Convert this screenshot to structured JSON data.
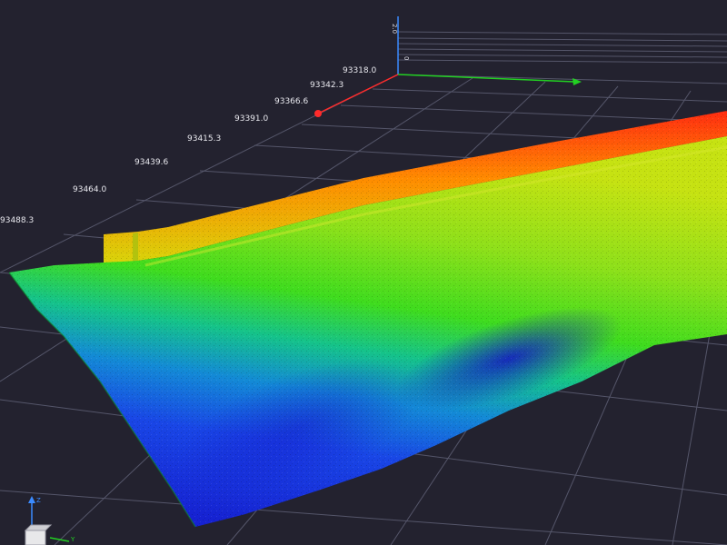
{
  "viewer": {
    "background": "#23222f",
    "grid_color": "#55566a",
    "axis_colors": {
      "x": "#ff2b2b",
      "y": "#22d022",
      "z": "#3b8bff"
    }
  },
  "axis_ticks": {
    "values": [
      "93318.0",
      "93342.3",
      "93366.6",
      "93391.0",
      "93415.3",
      "93439.6",
      "93464.0",
      "93488.3"
    ]
  },
  "z_axis_ticks": {
    "values": [
      "2.0",
      "0"
    ]
  },
  "orientation_widget": {
    "z_label": "Z",
    "y_label": "Y"
  },
  "surface": {
    "color_scale": [
      "#1a23d6",
      "#0a7ae8",
      "#12c9a6",
      "#3fe020",
      "#b9e210",
      "#ffb000",
      "#ff3a10"
    ]
  }
}
